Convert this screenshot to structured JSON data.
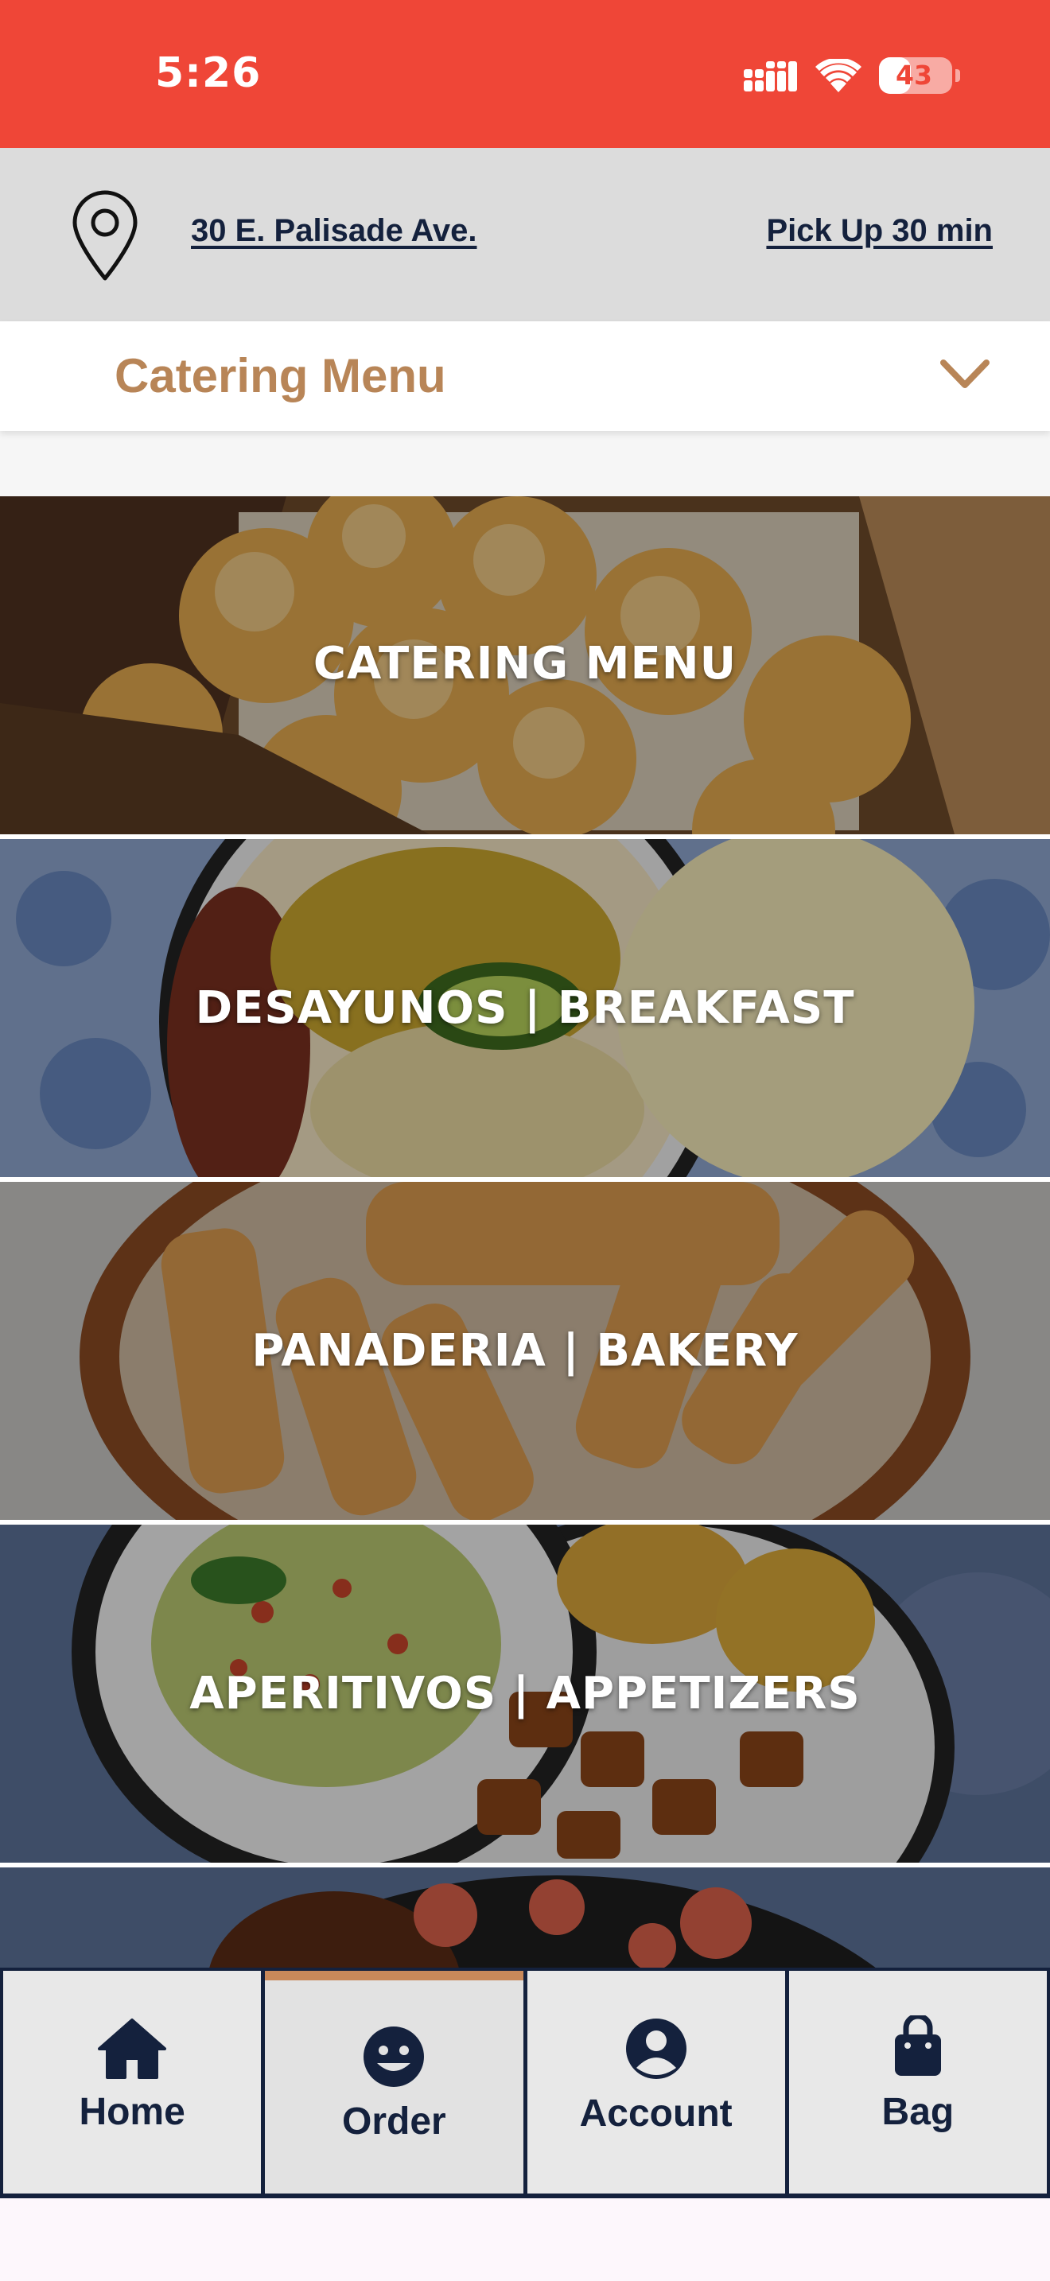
{
  "status_bar": {
    "time": "5:26",
    "battery": "43",
    "battery_level": 0.43,
    "icons": [
      "cellular-signal-icon",
      "wifi-icon",
      "battery-icon"
    ]
  },
  "location": {
    "address": "30 E. Palisade Ave.",
    "pickup": "Pick Up 30 min",
    "icon": "location-pin-icon"
  },
  "menu_selector": {
    "label": "Catering Menu",
    "icon": "chevron-down-icon"
  },
  "categories": [
    {
      "label": "CATERING MENU"
    },
    {
      "label": "DESAYUNOS | BREAKFAST"
    },
    {
      "label": "PANADERIA | BAKERY"
    },
    {
      "label": "APERITIVOS | APPETIZERS"
    },
    {
      "label": ""
    }
  ],
  "tabs": [
    {
      "label": "Home",
      "icon": "home-icon",
      "active": false
    },
    {
      "label": "Order",
      "icon": "smiley-icon",
      "active": true
    },
    {
      "label": "Account",
      "icon": "account-icon",
      "active": false
    },
    {
      "label": "Bag",
      "icon": "bag-icon",
      "active": false
    }
  ],
  "colors": {
    "status_bar": "#ef4637",
    "accent": "#b88557",
    "navy": "#14213d",
    "active_tab": "#c9895a"
  }
}
